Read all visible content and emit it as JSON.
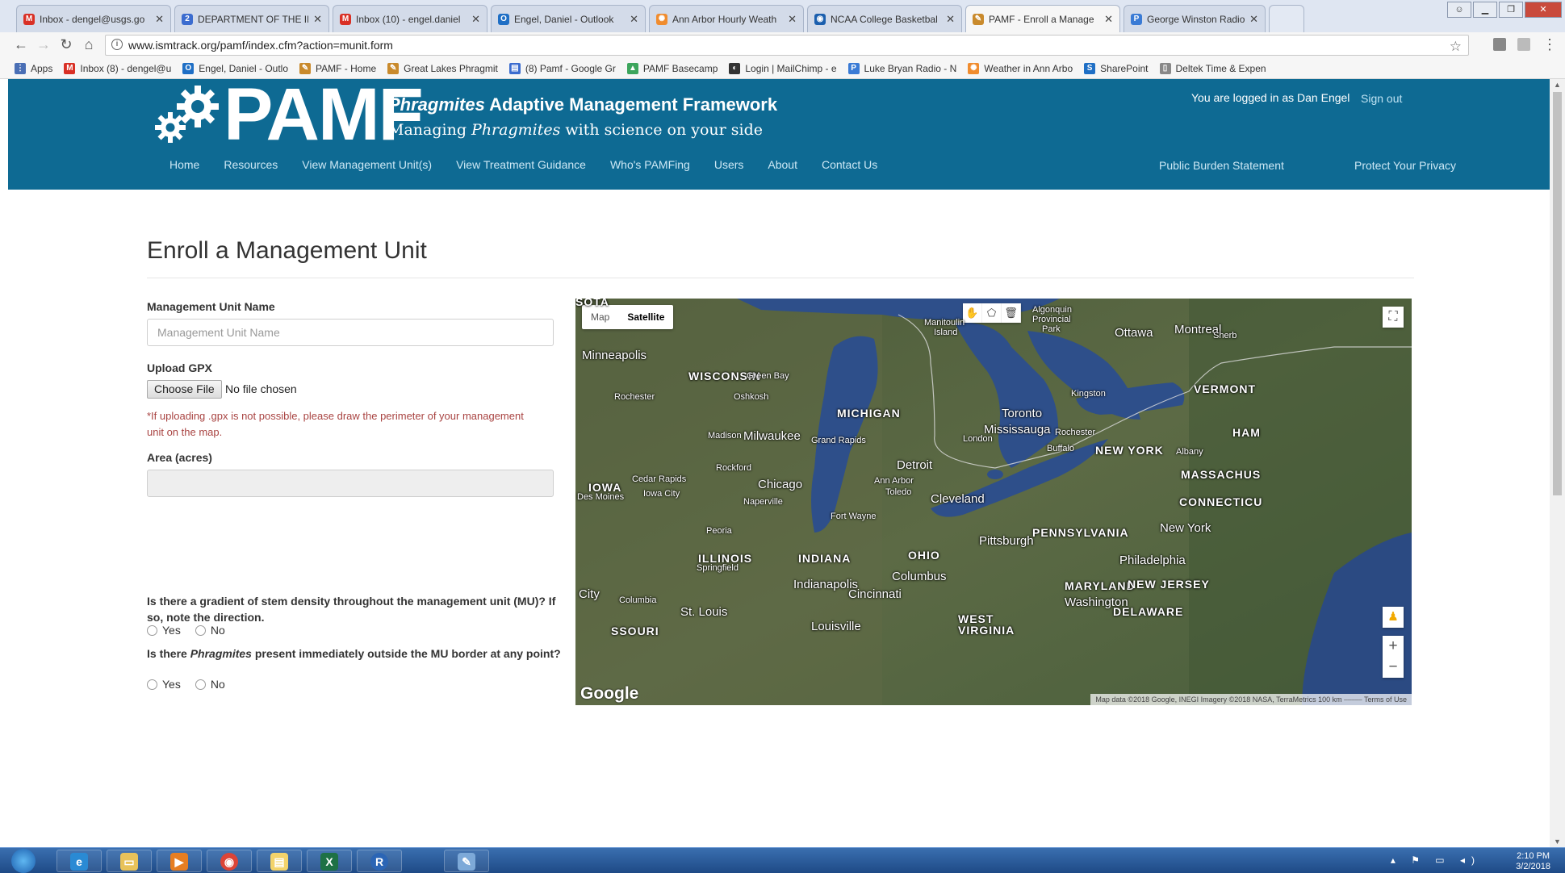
{
  "browser": {
    "tabs": [
      {
        "label": "Inbox - dengel@usgs.go",
        "icon_color": "#d93025",
        "icon": "M"
      },
      {
        "label": "DEPARTMENT OF THE IN",
        "icon_color": "#3b6ccf",
        "icon": "2"
      },
      {
        "label": "Inbox (10) - engel.daniel",
        "icon_color": "#d93025",
        "icon": "M"
      },
      {
        "label": "Engel, Daniel - Outlook",
        "icon_color": "#1f6fc5",
        "icon": "O"
      },
      {
        "label": "Ann Arbor Hourly Weath",
        "icon_color": "#f08c2e",
        "icon": "✺"
      },
      {
        "label": "NCAA College Basketbal",
        "icon_color": "#1b5fae",
        "icon": "◉"
      },
      {
        "label": "PAMF - Enroll a Manage",
        "icon_color": "#c98a2c",
        "icon": "✎",
        "active": true
      },
      {
        "label": "George Winston Radio -",
        "icon_color": "#3a7bd5",
        "icon": "P"
      }
    ],
    "url": "www.ismtrack.org/pamf/index.cfm?action=munit.form",
    "bookmarks": [
      {
        "label": "Apps",
        "icon_color": "#4a6fb5",
        "icon": "⋮"
      },
      {
        "label": "Inbox (8) - dengel@u",
        "icon_color": "#d93025",
        "icon": "M"
      },
      {
        "label": "Engel, Daniel - Outlo",
        "icon_color": "#1f6fc5",
        "icon": "O"
      },
      {
        "label": "PAMF - Home",
        "icon_color": "#c98a2c",
        "icon": "✎"
      },
      {
        "label": "Great Lakes Phragmit",
        "icon_color": "#c98a2c",
        "icon": "✎"
      },
      {
        "label": "(8) Pamf - Google Gr",
        "icon_color": "#3b6ccf",
        "icon": "▤"
      },
      {
        "label": "PAMF Basecamp",
        "icon_color": "#3ca55c",
        "icon": "▲"
      },
      {
        "label": "Login | MailChimp - e",
        "icon_color": "#333333",
        "icon": "◐"
      },
      {
        "label": "Luke Bryan Radio - N",
        "icon_color": "#3a7bd5",
        "icon": "P"
      },
      {
        "label": "Weather in Ann Arbo",
        "icon_color": "#f08c2e",
        "icon": "✺"
      },
      {
        "label": "SharePoint",
        "icon_color": "#1f6fc5",
        "icon": "S"
      },
      {
        "label": "Deltek Time & Expen",
        "icon_color": "#888888",
        "icon": "▯"
      }
    ]
  },
  "header": {
    "logo_text": "PAMF",
    "title_italic": "Phragmites",
    "title_rest": " Adaptive Management Framework",
    "tagline_pre": "Managing ",
    "tagline_italic": "Phragmites",
    "tagline_post": " with science on your side",
    "logged_in": "You are logged in as Dan Engel",
    "sign_out": "Sign out",
    "nav": [
      "Home",
      "Resources",
      "View Management Unit(s)",
      "View Treatment Guidance",
      "Who's PAMFing",
      "Users",
      "About",
      "Contact Us"
    ],
    "public_burden": "Public Burden Statement",
    "privacy": "Protect Your Privacy",
    "bg_color": "#0e6a93"
  },
  "form": {
    "page_title": "Enroll a Management Unit",
    "mu_name_label": "Management Unit Name",
    "mu_name_placeholder": "Management Unit Name",
    "upload_label": "Upload GPX",
    "choose_file": "Choose File",
    "no_file": "No file chosen",
    "gpx_note": "*If uploading .gpx is not possible, please draw the perimeter of your management unit on the map.",
    "area_label": "Area (acres)",
    "area_value": "",
    "q1": "Is there a gradient of stem density throughout the management unit (MU)? If so, note the direction.",
    "q2_pre": "Is there ",
    "q2_italic": "Phragmites",
    "q2_post": " present immediately outside the MU border at any point?",
    "yes": "Yes",
    "no": "No"
  },
  "map": {
    "type_map": "Map",
    "type_satellite": "Satellite",
    "selected_type": "Satellite",
    "google": "Google",
    "attribution": "Map data ©2018 Google, INEGI Imagery ©2018 NASA, TerraMetrics   100 km ⎯⎯⎯⎯⎯    Terms of Use",
    "labels": {
      "sota": "SOTA",
      "algonquin": "Algonquin",
      "provincial": "Provincial",
      "park": "Park",
      "ottawa": "Ottawa",
      "montreal": "Montreal",
      "sherb": "Sherb",
      "manitoulin": "Manitoulin",
      "island": "Island",
      "minneapolis": "Minneapolis",
      "wisconsin": "WISCONSIN",
      "green_bay": "Green Bay",
      "oshkosh": "Oshkosh",
      "rochester_mn": "Rochester",
      "michigan": "MICHIGAN",
      "kingston": "Kingston",
      "vermont": "VERMONT",
      "toronto": "Toronto",
      "mississauga": "Mississauga",
      "rochester_ny": "Rochester",
      "ham": "HAM",
      "madison": "Madison",
      "milwaukee": "Milwaukee",
      "grand_rapids": "Grand Rapids",
      "london": "London",
      "buffalo": "Buffalo",
      "new_york_state": "NEW YORK",
      "albany": "Albany",
      "rockford": "Rockford",
      "detroit": "Detroit",
      "massachusetts": "MASSACHUS",
      "iowa": "IOWA",
      "des_moines": "Des Moines",
      "cedar_rapids": "Cedar Rapids",
      "iowa_city": "Iowa City",
      "chicago": "Chicago",
      "ann_arbor": "Ann Arbor",
      "toledo": "Toledo",
      "cleveland": "Cleveland",
      "connecticut": "CONNECTICU",
      "naperville": "Naperville",
      "fort_wayne": "Fort Wayne",
      "pennsylvania": "PENNSYLVANIA",
      "new_york_city": "New York",
      "peoria": "Peoria",
      "pittsburgh": "Pittsburgh",
      "ohio": "OHIO",
      "illinois": "ILLINOIS",
      "springfield": "Springfield",
      "indiana": "INDIANA",
      "philadelphia": "Philadelphia",
      "columbus": "Columbus",
      "indianapolis": "Indianapolis",
      "maryland": "MARYLAND",
      "new_jersey": "NEW JERSEY",
      "city": "City",
      "cincinnati": "Cincinnati",
      "washington": "Washington",
      "columbia": "Columbia",
      "st_louis": "St. Louis",
      "delaware": "DELAWARE",
      "west_virginia": "WEST\nVIRGINIA",
      "louisville": "Louisville",
      "missouri": "SSOURI"
    }
  },
  "taskbar": {
    "time": "2:10 PM",
    "date": "3/2/2018"
  }
}
